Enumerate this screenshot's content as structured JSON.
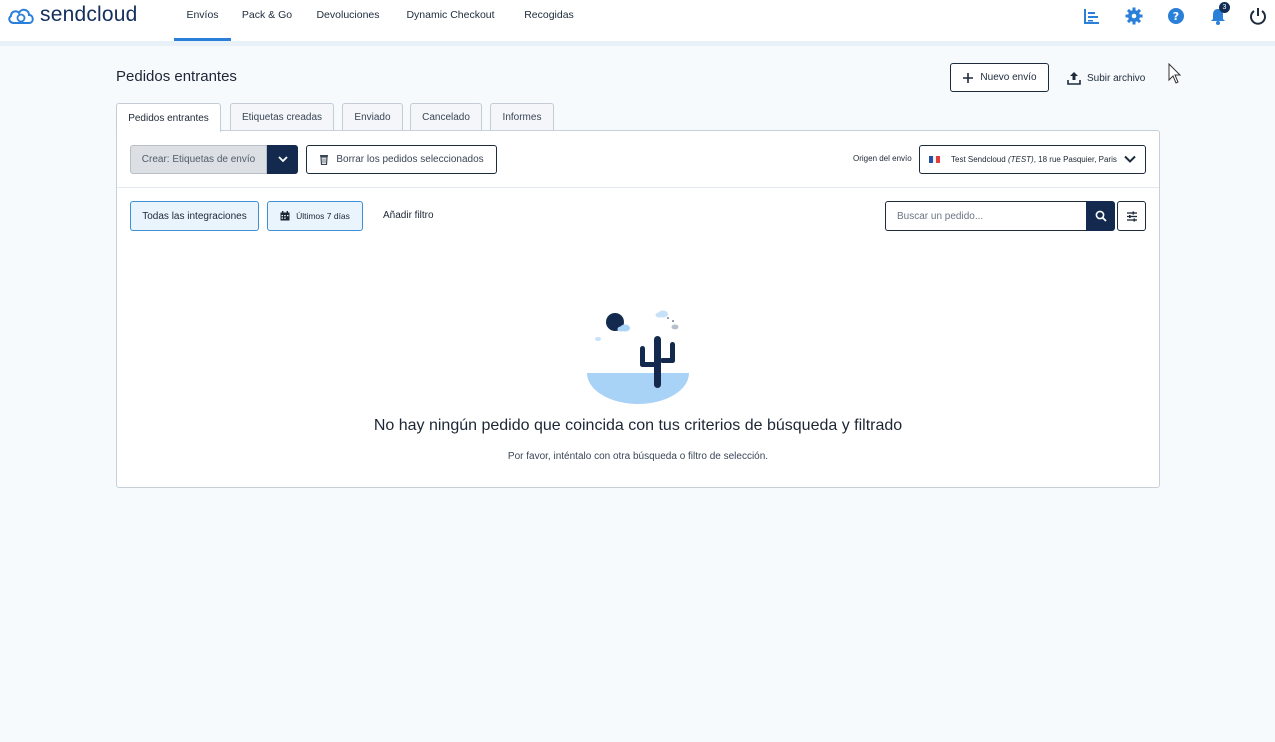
{
  "app": {
    "logo_text": "sendcloud"
  },
  "nav": {
    "items": [
      {
        "label": "Envíos",
        "active": true
      },
      {
        "label": "Pack & Go",
        "active": false
      },
      {
        "label": "Devoluciones",
        "active": false
      },
      {
        "label": "Dynamic Checkout",
        "active": false
      },
      {
        "label": "Recogidas",
        "active": false
      }
    ],
    "icons": [
      "analytics-icon",
      "settings-gear-icon",
      "help-icon",
      "notifications-bell-icon",
      "power-icon"
    ],
    "notification_count": "3"
  },
  "page": {
    "title": "Pedidos entrantes",
    "new_shipment_label": "Nuevo envío",
    "upload_label": "Subir archivo"
  },
  "tabs": [
    {
      "label": "Pedidos entrantes",
      "active": true
    },
    {
      "label": "Etiquetas creadas",
      "active": false
    },
    {
      "label": "Enviado",
      "active": false
    },
    {
      "label": "Cancelado",
      "active": false
    },
    {
      "label": "Informes",
      "active": false
    }
  ],
  "toolbar": {
    "create_label": "Crear: Etiquetas de envío",
    "delete_label": "Borrar los pedidos seleccionados",
    "origin_label": "Origen del envío",
    "origin_name": "Test Sendcloud",
    "origin_test": "(TEST)",
    "origin_address": ", 18 rue Pasquier, Paris"
  },
  "filters": {
    "integrations_label": "Todas las integraciones",
    "date_label": "Últimos 7 días",
    "add_filter_label": "Añadir filtro",
    "search_placeholder": "Buscar un pedido..."
  },
  "empty_state": {
    "title": "No hay ningún pedido que coincida con tus criterios de búsqueda y filtrado",
    "subtitle": "Por favor, inténtalo con otra búsqueda o filtro de selección."
  },
  "colors": {
    "accent": "#2a7fd8",
    "navy": "#132a4e",
    "filter_bg": "#eaf4fd",
    "page_bg": "#f7fafd"
  }
}
